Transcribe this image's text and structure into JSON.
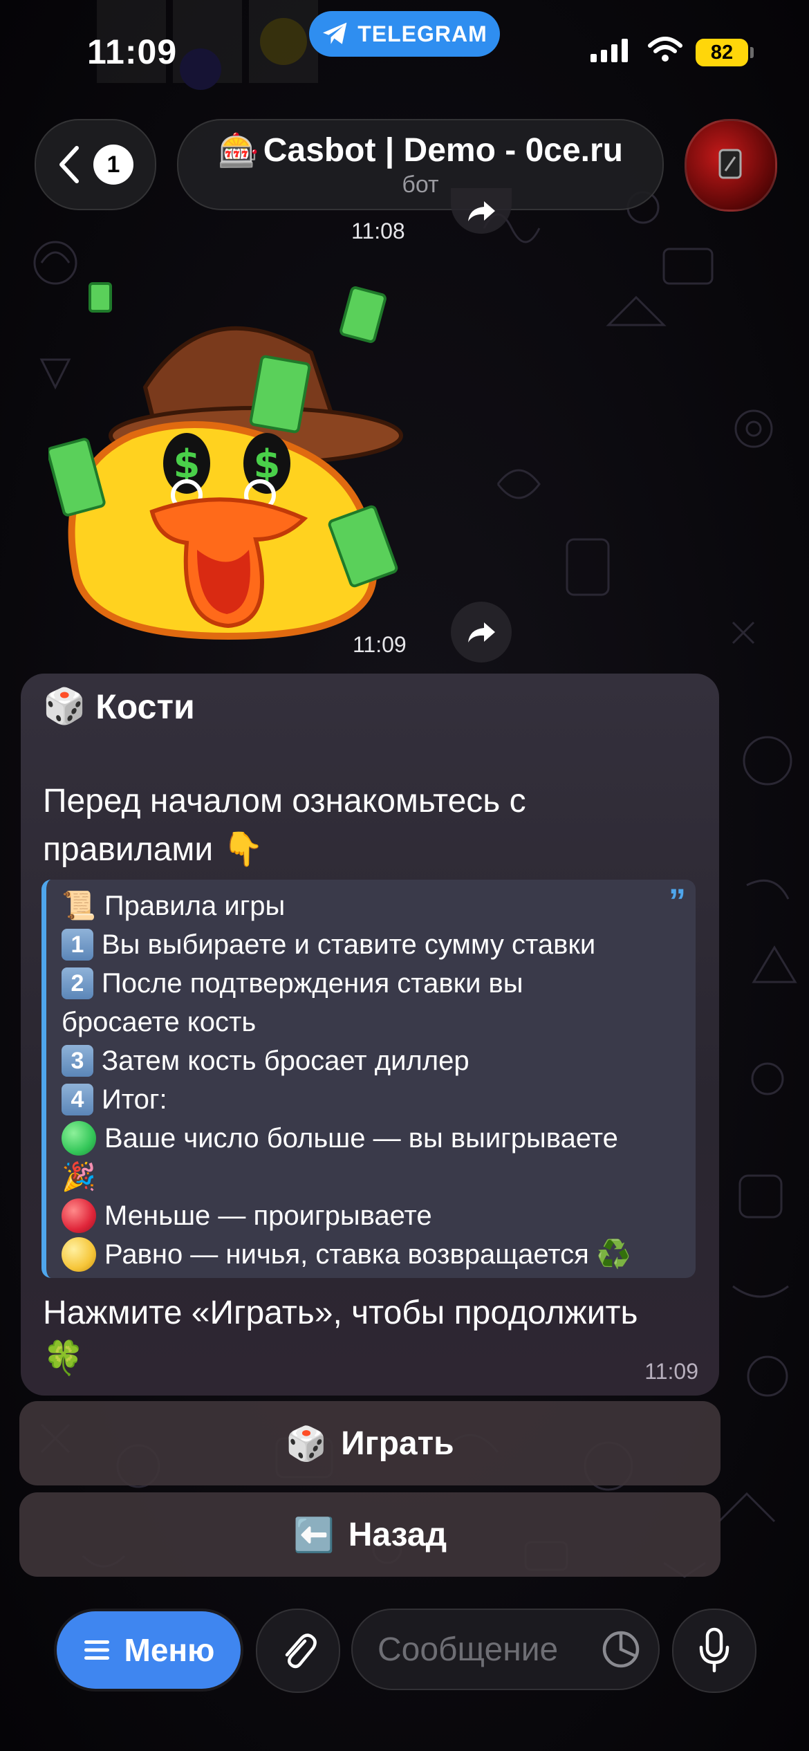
{
  "status_bar": {
    "time": "11:09",
    "app_pill": "TELEGRAM",
    "battery": "82"
  },
  "header": {
    "back_badge": "1",
    "chat_title": "Casbot | Demo - 0ce.ru",
    "title_emoji": "🎰",
    "subtitle": "бот"
  },
  "feed": {
    "prev_time": "11:08",
    "sticker_time": "11:09"
  },
  "message": {
    "heading_emoji": "🎲",
    "heading": "Кости",
    "intro": "Перед началом ознакомьтесь с правилами 👇",
    "quote": {
      "title_emoji": "📜",
      "title": "Правила игры",
      "steps": [
        {
          "key": "1",
          "text": "Вы выбираете и ставите сумму ставки"
        },
        {
          "key": "2",
          "text": "После подтверждения ставки вы",
          "cont": "бросаете кость"
        },
        {
          "key": "3",
          "text": "Затем кость бросает диллер"
        },
        {
          "key": "4",
          "text": "Итог:"
        }
      ],
      "outcomes": [
        {
          "text": "Ваше число больше — вы выигрываете",
          "cont": "🎉",
          "color": "#34c759"
        },
        {
          "text": "Меньше — проигрываете",
          "color": "#e0263a"
        },
        {
          "text": "Равно — ничья, ставка возвращается ♻️",
          "color": "#f6c63a"
        }
      ]
    },
    "outro": "Нажмите «Играть», чтобы продолжить",
    "outro_emoji": "🍀",
    "time": "11:09"
  },
  "keyboard": {
    "play_emoji": "🎲",
    "play_label": "Играть",
    "back_emoji": "⬅️",
    "back_label": "Назад"
  },
  "input_bar": {
    "menu_label": "Меню",
    "placeholder": "Сообщение"
  },
  "icons": {
    "telegram": "telegram-plane-icon",
    "back": "chevron-left-icon",
    "forward": "share-arrow-icon",
    "attach": "paperclip-icon",
    "sticker": "sticker-clock-icon",
    "mic": "microphone-icon",
    "menu": "hamburger-icon"
  },
  "colors": {
    "accent": "#3f86f0",
    "quote_bar": "#4fa6ec",
    "battery": "#ffd60a"
  }
}
